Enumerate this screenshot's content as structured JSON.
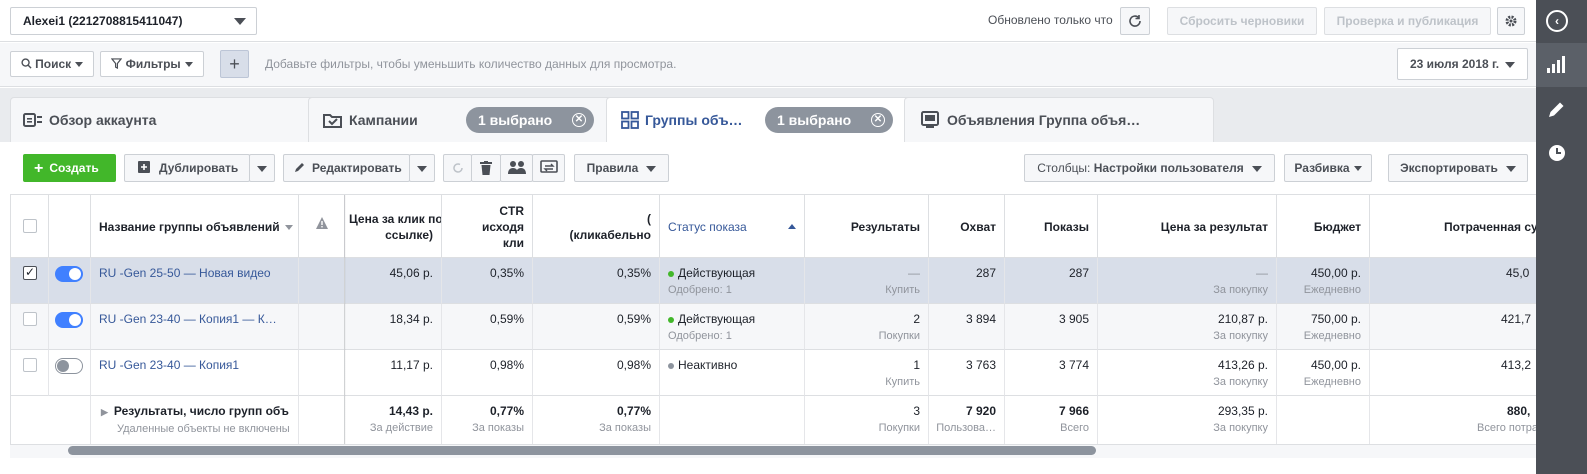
{
  "topbar": {
    "account": "Alexei1 (2212708815411047)",
    "updated": "Обновлено только что",
    "discard": "Сбросить черновики",
    "publish": "Проверка и публикация"
  },
  "filterbar": {
    "search": "Поиск",
    "filters": "Фильтры",
    "add": "+",
    "placeholder": "Добавьте фильтры, чтобы уменьшить количество данных для просмотра.",
    "date": "23 июля 2018 г."
  },
  "tabs": [
    {
      "label": "Обзор аккаунта"
    },
    {
      "label": "Кампании",
      "pill": "1 выбрано"
    },
    {
      "label": "Группы объ…",
      "pill": "1 выбрано"
    },
    {
      "label": "Объявления Группа объя…"
    }
  ],
  "toolbar": {
    "create": "Создать",
    "duplicate": "Дублировать",
    "edit": "Редактировать",
    "rules": "Правила",
    "columns_prefix": "Столбцы: ",
    "columns_value": "Настройки пользователя",
    "breakdown": "Разбивка",
    "export": "Экспортировать"
  },
  "columns": {
    "name": "Название группы объявлений",
    "cpc": "Цена за клик по ссылке",
    "cpc_l1": "Цена за клик по",
    "cpc_l2": "ссылке)",
    "ctr_l1": "CTR",
    "ctr_l2": "исходя",
    "ctr_l3": "кли",
    "ctr2_l1": "(",
    "ctr2_l2": "(кликабельно",
    "status": "Статус показа",
    "results": "Результаты",
    "reach": "Охват",
    "impressions": "Показы",
    "cost_per_result": "Цена за результат",
    "budget": "Бюджет",
    "spent": "Потраченная су"
  },
  "rows": [
    {
      "name": "RU -Gen 25-50 — Новая видео",
      "cpc": "45,06 р.",
      "ctr": "0,35%",
      "ctr2": "0,35%",
      "status": "Действующая",
      "status_sub": "Одобрено: 1",
      "results": "—",
      "results_sub": "Купить",
      "reach": "287",
      "impressions": "287",
      "cpr": "—",
      "cpr_sub": "За покупку",
      "budget": "450,00 р.",
      "budget_sub": "Ежедневно",
      "spent": "45,0"
    },
    {
      "name": "RU -Gen 23-40 — Копия1 — К…",
      "cpc": "18,34 р.",
      "ctr": "0,59%",
      "ctr2": "0,59%",
      "status": "Действующая",
      "status_sub": "Одобрено: 1",
      "results": "2",
      "results_sub": "Покупки",
      "reach": "3 894",
      "impressions": "3 905",
      "cpr": "210,87 р.",
      "cpr_sub": "За покупку",
      "budget": "750,00 р.",
      "budget_sub": "Ежедневно",
      "spent": "421,7"
    },
    {
      "name": "RU -Gen 23-40 — Копия1",
      "cpc": "11,17 р.",
      "ctr": "0,98%",
      "ctr2": "0,98%",
      "status": "Неактивно",
      "status_sub": "",
      "results": "1",
      "results_sub": "Купить",
      "reach": "3 763",
      "impressions": "3 774",
      "cpr": "413,26 р.",
      "cpr_sub": "За покупку",
      "budget": "450,00 р.",
      "budget_sub": "Ежедневно",
      "spent": "413,2"
    }
  ],
  "totals": {
    "name": "Результаты, число групп объ",
    "name_sub": "Удаленные объекты не включены",
    "cpc": "14,43 р.",
    "cpc_sub": "За действие",
    "ctr": "0,77%",
    "ctr_sub": "За показы",
    "ctr2": "0,77%",
    "ctr2_sub": "За показы",
    "results": "3",
    "results_sub": "Покупки",
    "reach": "7 920",
    "reach_sub": "Пользова…",
    "impressions": "7 966",
    "impressions_sub": "Всего",
    "cpr": "293,35 р.",
    "cpr_sub": "За покупку",
    "spent": "880,",
    "spent_sub": "Всего потра"
  },
  "colors": {
    "accent": "#4080ff",
    "create": "#42b72a",
    "active_status": "#42b72a",
    "inactive_status": "#8d949e",
    "link": "#365899"
  }
}
